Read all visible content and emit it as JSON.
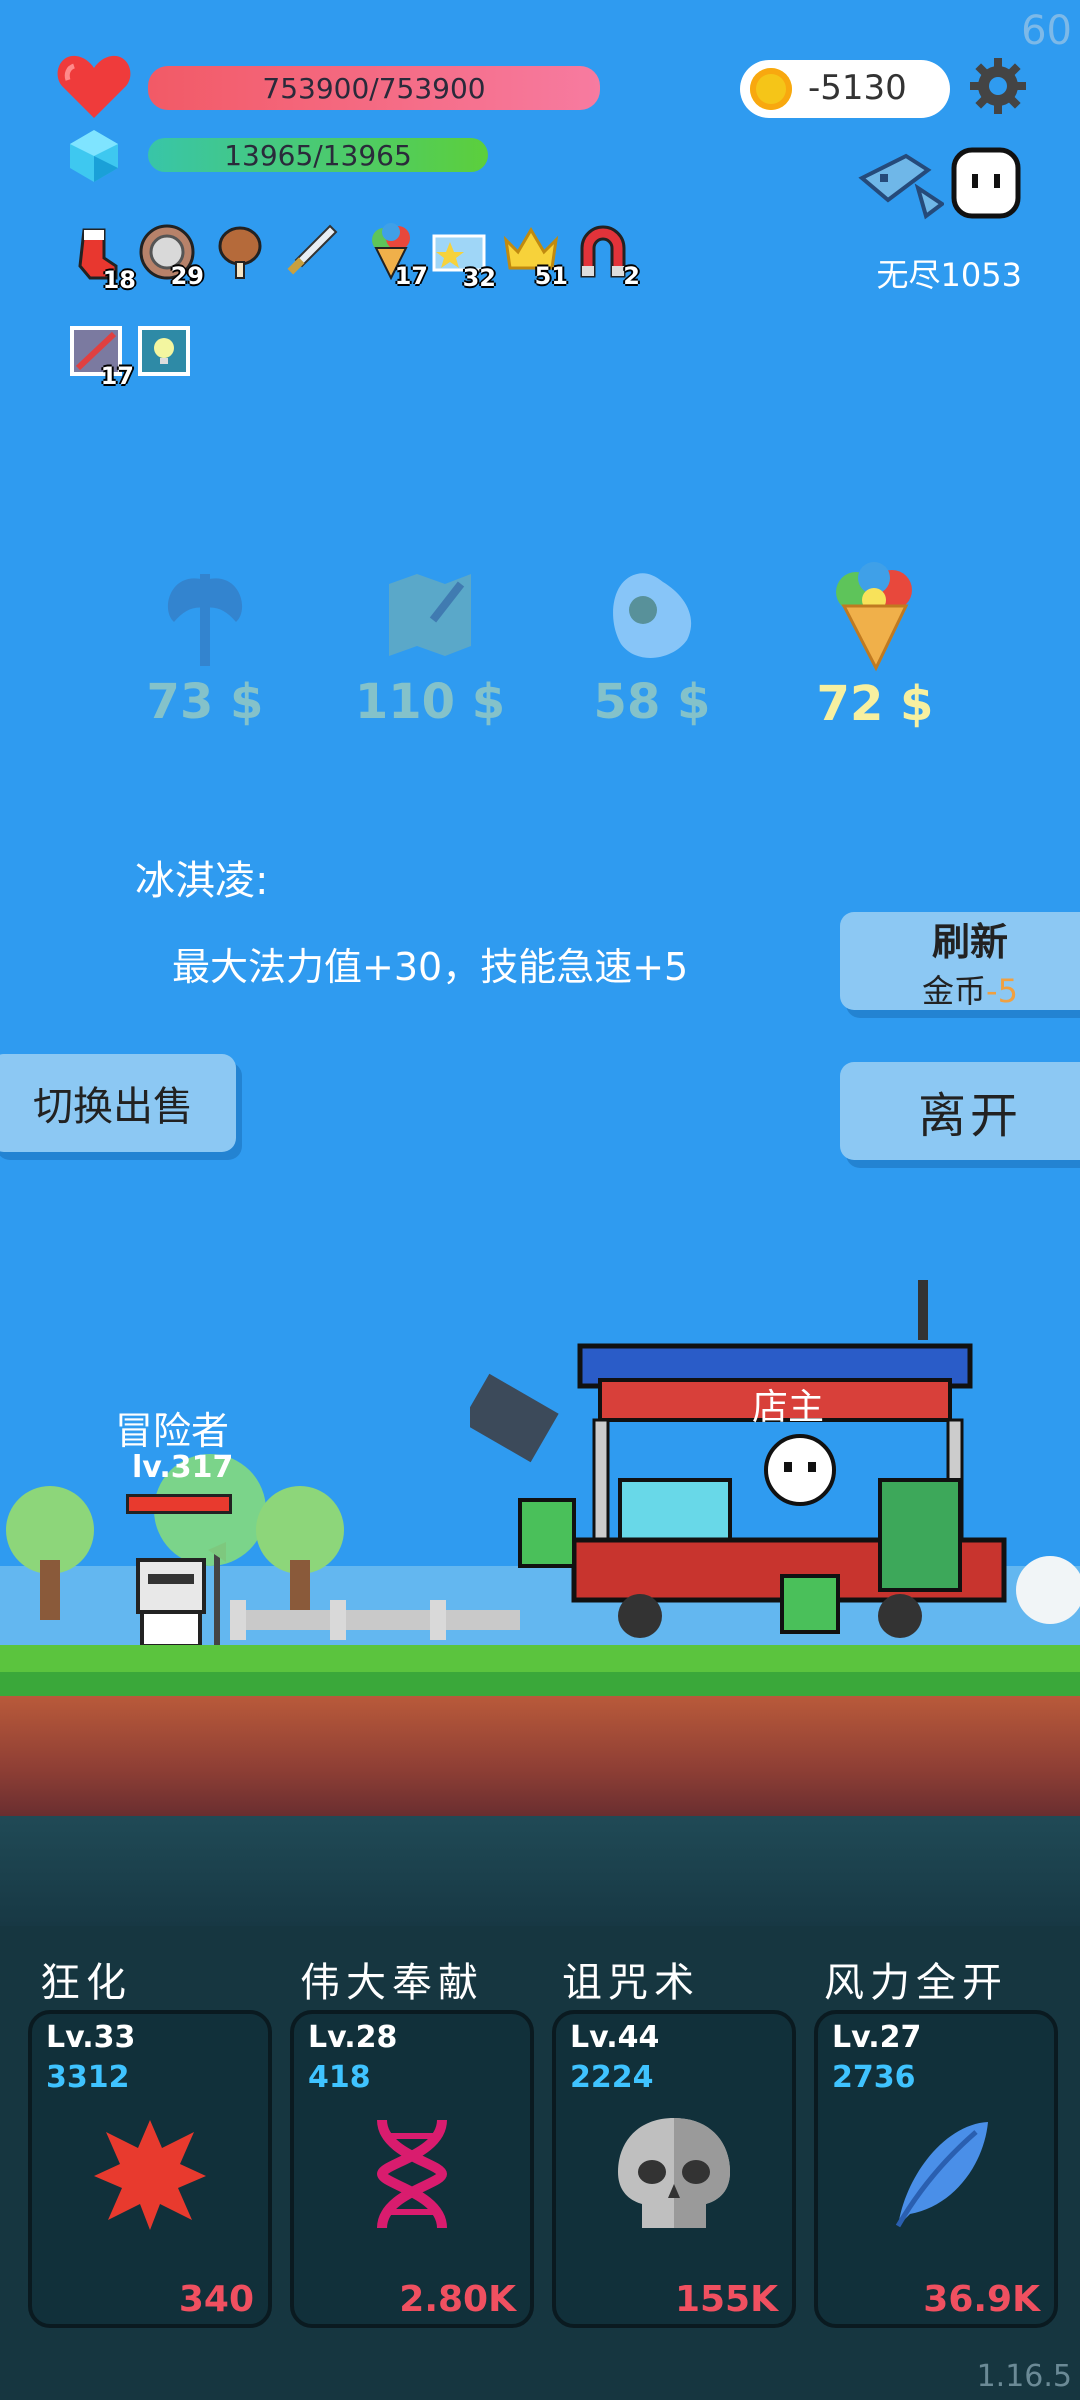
{
  "corner": {
    "fps": "60",
    "version": "1.16.5"
  },
  "hud": {
    "hp": "753900/753900",
    "mp": "13965/13965",
    "coins": "-5130",
    "mode_label": "无尽1053",
    "hp_fill": 1.0,
    "mp_fill": 1.0
  },
  "inventory": [
    {
      "icon": "sock-icon",
      "count": "18"
    },
    {
      "icon": "shield-icon",
      "count": "29"
    },
    {
      "icon": "drumstick-icon",
      "count": ""
    },
    {
      "icon": "sword-icon",
      "count": ""
    },
    {
      "icon": "ice-cream-icon",
      "count": "17"
    },
    {
      "icon": "star-card-icon",
      "count": "32"
    },
    {
      "icon": "crown-icon",
      "count": "51"
    },
    {
      "icon": "magnet-icon",
      "count": "2"
    },
    {
      "icon": "scroll-icon",
      "count": "17"
    },
    {
      "icon": "lamp-icon",
      "count": ""
    }
  ],
  "shop": {
    "items": [
      {
        "icon": "axe-icon",
        "price": "73 $"
      },
      {
        "icon": "map-icon",
        "price": "110 $"
      },
      {
        "icon": "egg-icon",
        "price": "58 $"
      },
      {
        "icon": "ice-cream-icon",
        "price": "72 $"
      }
    ],
    "selected_name": "冰淇凌:",
    "selected_desc": "最大法力值+30，技能急速+5",
    "refresh_label": "刷新",
    "refresh_cost_label": "金币",
    "refresh_cost": "-5",
    "switch_label": "切换出售",
    "leave_label": "离开"
  },
  "scene": {
    "adventurer_name": "冒险者",
    "adventurer_level": "lv.317",
    "shopkeeper_label": "店主"
  },
  "skills": [
    {
      "name": "狂化",
      "level": "Lv.33",
      "value": "3312",
      "cost": "340",
      "icon": "splat-icon",
      "color": "#e83a2e"
    },
    {
      "name": "伟大奉献",
      "level": "Lv.28",
      "value": "418",
      "cost": "2.80K",
      "icon": "dna-icon",
      "color": "#d91c6e"
    },
    {
      "name": "诅咒术",
      "level": "Lv.44",
      "value": "2224",
      "cost": "155K",
      "icon": "skull-icon",
      "color": "#bfbfbf"
    },
    {
      "name": "风力全开",
      "level": "Lv.27",
      "value": "2736",
      "cost": "36.9K",
      "icon": "feather-icon",
      "color": "#4a8fe8"
    }
  ]
}
